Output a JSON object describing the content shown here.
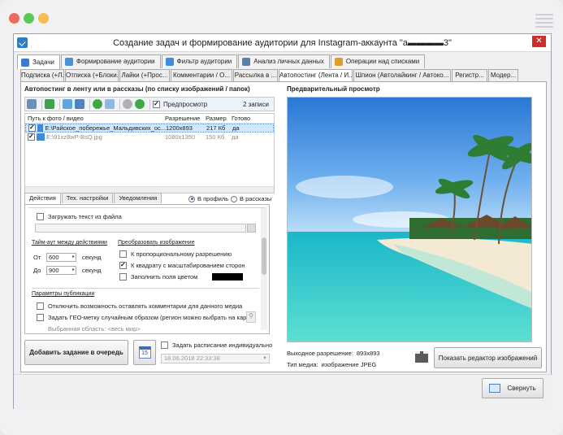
{
  "window": {
    "title": "Создание задач и формирование аудитории для Instagram-аккаунта \"a▬▬▬▬3\"",
    "close_label": "✕"
  },
  "colors": {
    "accent": "#1f75c5",
    "close": "#c9302c",
    "mac_red": "#ee6a5f",
    "mac_green": "#5cc85a",
    "mac_yellow": "#f5bd4f"
  },
  "main_tabs": [
    {
      "label": "Задачи",
      "icon": "tasks-icon",
      "active": true
    },
    {
      "label": "Формирование аудитории",
      "icon": "audience-icon"
    },
    {
      "label": "Фильтр аудитории",
      "icon": "filter-icon"
    },
    {
      "label": "Анализ личных данных",
      "icon": "analysis-icon"
    },
    {
      "label": "Операции над списками",
      "icon": "lists-icon"
    }
  ],
  "sub_tabs": [
    "Подписка (+Л...",
    "Отписка (+Блоки...",
    "Лайки (+Прос...",
    "Комментарии / О...",
    "Рассылка в ...",
    "Автопостинг (Лента / И...",
    "Шпион (Автолайкинг / Автоко...",
    "Регистр...",
    "Модер..."
  ],
  "left": {
    "section_title": "Автопостинг в ленту или в рассказы (по списку изображений / папок)",
    "preview_checkbox_label": "Предпросмотр",
    "records_count": "2 записи",
    "table": {
      "headers": [
        "Путь к фото / видео",
        "Разрешение",
        "Размер",
        "Готово"
      ],
      "rows": [
        {
          "path": "E:\\Райское_побережье_Мальдивских_ос...",
          "resolution": "1200x893",
          "size": "217 Кб",
          "ready": "да"
        },
        {
          "path": "E:\\91xz8wP-BsQ.jpg",
          "resolution": "1080x1350",
          "size": "150 Кб",
          "ready": "да"
        }
      ]
    },
    "bottom_tabs": [
      "Действия",
      "Тех. настройки",
      "Уведомления"
    ],
    "radio_profile": "В профиль",
    "radio_stories": "В рассказы",
    "load_text_label": "Загружать текст из файла",
    "timeout_title": "Тайм-аут между действиями",
    "from_label": "От",
    "to_label": "До",
    "from_value": "600",
    "to_value": "900",
    "seconds_label": "секунд",
    "convert_title": "Преобразовать изображение",
    "opt_proportional": "К пропорциональному разрешению",
    "opt_square": "К квадрату с масштабированием сторон",
    "opt_fill": "Заполнить поля цветом",
    "fill_color": "#000000",
    "params_title": "Параметры публикации",
    "opt_disable_comments": "Отключить возможность оставлять комментарии для данного медиа",
    "opt_geo": "Задать ГЕО-метку случайным образом (регион можно выбрать на карте)",
    "selected_area": "Выбранная область: <весь мир>",
    "add_task_button": "Добавить задание в очередь",
    "calendar_day": "15",
    "schedule_label": "Задать расписание индивидуально",
    "schedule_value": "18.06.2018 22:33:38"
  },
  "right": {
    "preview_title": "Предварительный просмотр",
    "output_resolution_label": "Выходное разрешение:",
    "output_resolution_value": "893x893",
    "media_type_label": "Тип медиа:",
    "media_type_value": "изображение JPEG",
    "editor_button": "Показать редактор изображений"
  },
  "footer": {
    "minimize_button": "Свернуть"
  }
}
